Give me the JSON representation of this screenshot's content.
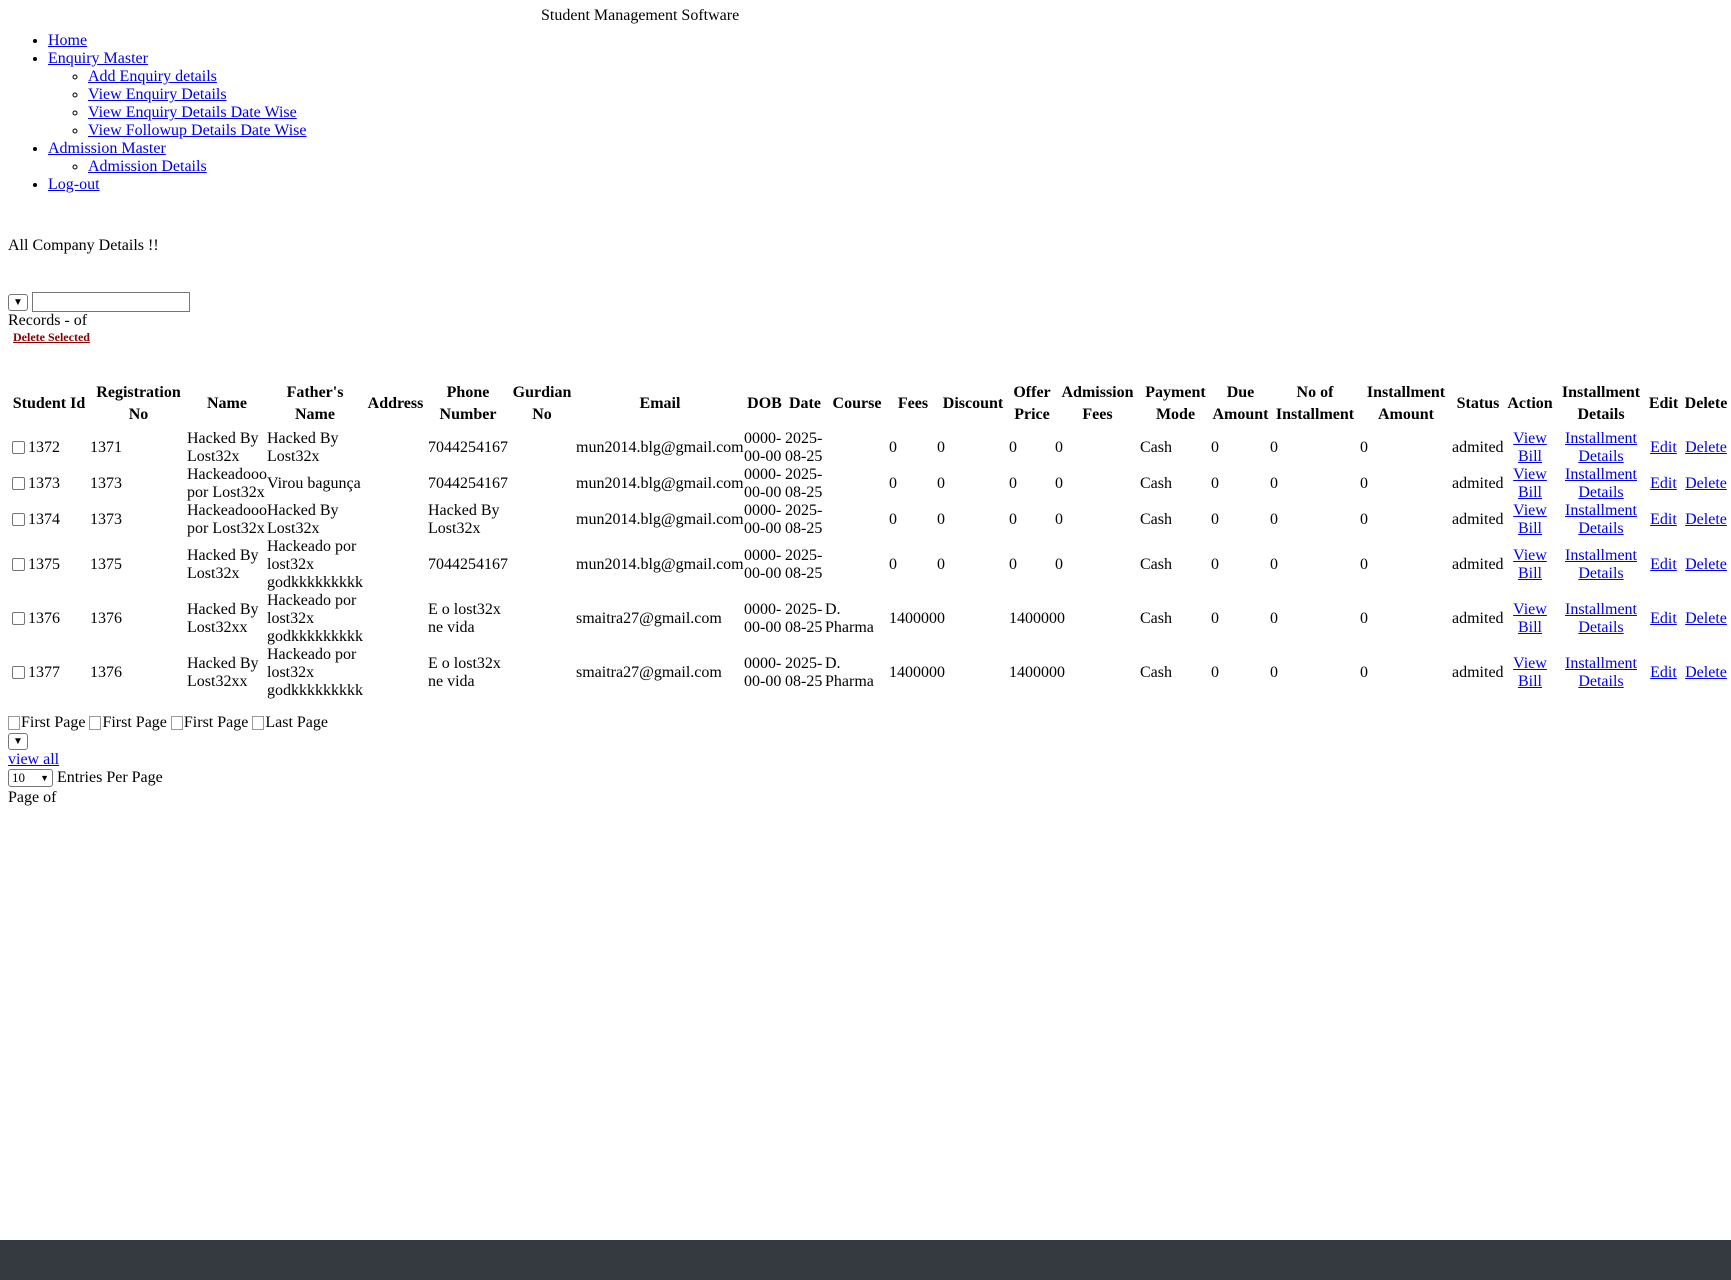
{
  "app": {
    "title": "Student Management Software"
  },
  "nav": {
    "home": "Home",
    "enquiry_master": "Enquiry Master",
    "enquiry_sub": [
      "Add Enquiry details",
      "View Enquiry Details",
      "View Enquiry Details Date Wise",
      "View Followup Details Date Wise"
    ],
    "admission_master": "Admission Master",
    "admission_sub": [
      "Admission Details"
    ],
    "logout": "Log-out"
  },
  "page": {
    "heading": "All Company Details !!",
    "records_text": "Records - of",
    "delete_selected": "Delete Selected"
  },
  "table": {
    "headers": [
      "Student Id",
      "Registration No",
      "Name",
      "Father's Name",
      "Address",
      "Phone Number",
      "Gurdian No",
      "Email",
      "DOB",
      "Date",
      "Course",
      "Fees",
      "Discount",
      "Offer Price",
      "Admission Fees",
      "Payment Mode",
      "Due Amount",
      "No of Installment",
      "Installment Amount",
      "Status",
      "Action",
      "Installment Details",
      "Edit",
      "Delete"
    ],
    "rows": [
      {
        "id": "1372",
        "reg": "1371",
        "name": "Hacked By Lost32x",
        "father": "Hacked By Lost32x",
        "address": "",
        "phone": "7044254167",
        "guardian": "",
        "email": "mun2014.blg@gmail.com",
        "dob": "0000-00-00",
        "date": "2025-08-25",
        "course": "",
        "fees": "0",
        "discount": "0",
        "offer": "0",
        "admission": "0",
        "mode": "Cash",
        "due": "0",
        "no_inst": "0",
        "inst_amt": "0",
        "status": "admited",
        "action": "View Bill",
        "inst_details": "Installment Details",
        "edit": "Edit",
        "delete": "Delete"
      },
      {
        "id": "1373",
        "reg": "1373",
        "name": "Hackeadooo por Lost32x",
        "father": "Virou bagunça",
        "address": "",
        "phone": "7044254167",
        "guardian": "",
        "email": "mun2014.blg@gmail.com",
        "dob": "0000-00-00",
        "date": "2025-08-25",
        "course": "",
        "fees": "0",
        "discount": "0",
        "offer": "0",
        "admission": "0",
        "mode": "Cash",
        "due": "0",
        "no_inst": "0",
        "inst_amt": "0",
        "status": "admited",
        "action": "View Bill",
        "inst_details": "Installment Details",
        "edit": "Edit",
        "delete": "Delete"
      },
      {
        "id": "1374",
        "reg": "1373",
        "name": "Hackeadooo por Lost32x",
        "father": "Hacked By Lost32x",
        "address": "",
        "phone": "Hacked By Lost32x",
        "guardian": "",
        "email": "mun2014.blg@gmail.com",
        "dob": "0000-00-00",
        "date": "2025-08-25",
        "course": "",
        "fees": "0",
        "discount": "0",
        "offer": "0",
        "admission": "0",
        "mode": "Cash",
        "due": "0",
        "no_inst": "0",
        "inst_amt": "0",
        "status": "admited",
        "action": "View Bill",
        "inst_details": "Installment Details",
        "edit": "Edit",
        "delete": "Delete"
      },
      {
        "id": "1375",
        "reg": "1375",
        "name": "Hacked By Lost32x",
        "father": "Hackeado por lost32x godkkkkkkkkk",
        "address": "",
        "phone": "7044254167",
        "guardian": "",
        "email": "mun2014.blg@gmail.com",
        "dob": "0000-00-00",
        "date": "2025-08-25",
        "course": "",
        "fees": "0",
        "discount": "0",
        "offer": "0",
        "admission": "0",
        "mode": "Cash",
        "due": "0",
        "no_inst": "0",
        "inst_amt": "0",
        "status": "admited",
        "action": "View Bill",
        "inst_details": "Installment Details",
        "edit": "Edit",
        "delete": "Delete"
      },
      {
        "id": "1376",
        "reg": "1376",
        "name": "Hacked By Lost32xx",
        "father": "Hackeado por lost32x godkkkkkkkkk",
        "address": "",
        "phone": "E o lost32x ne vida",
        "guardian": "",
        "email": "smaitra27@gmail.com",
        "dob": "0000-00-00",
        "date": "2025-08-25",
        "course": "D. Pharma",
        "fees": "1400000",
        "discount": "",
        "offer": "1400000",
        "admission": "",
        "mode": "Cash",
        "due": "0",
        "no_inst": "0",
        "inst_amt": "0",
        "status": "admited",
        "action": "View Bill",
        "inst_details": "Installment Details",
        "edit": "Edit",
        "delete": "Delete"
      },
      {
        "id": "1377",
        "reg": "1376",
        "name": "Hacked By Lost32xx",
        "father": "Hackeado por lost32x godkkkkkkkkk",
        "address": "",
        "phone": "E o lost32x ne vida",
        "guardian": "",
        "email": "smaitra27@gmail.com",
        "dob": "0000-00-00",
        "date": "2025-08-25",
        "course": "D. Pharma",
        "fees": "1400000",
        "discount": "",
        "offer": "1400000",
        "admission": "",
        "mode": "Cash",
        "due": "0",
        "no_inst": "0",
        "inst_amt": "0",
        "status": "admited",
        "action": "View Bill",
        "inst_details": "Installment Details",
        "edit": "Edit",
        "delete": "Delete"
      }
    ]
  },
  "pager": {
    "images": [
      "First Page",
      "First Page",
      "First Page",
      "Last Page"
    ]
  },
  "footer_controls": {
    "view_all": "view all",
    "entries_value": "10",
    "entries_label": "Entries Per Page",
    "page_of": "Page of"
  },
  "colors": {
    "footer_bar": "#343a40",
    "link": "#0000ee",
    "delete_selected": "#8b0000"
  }
}
